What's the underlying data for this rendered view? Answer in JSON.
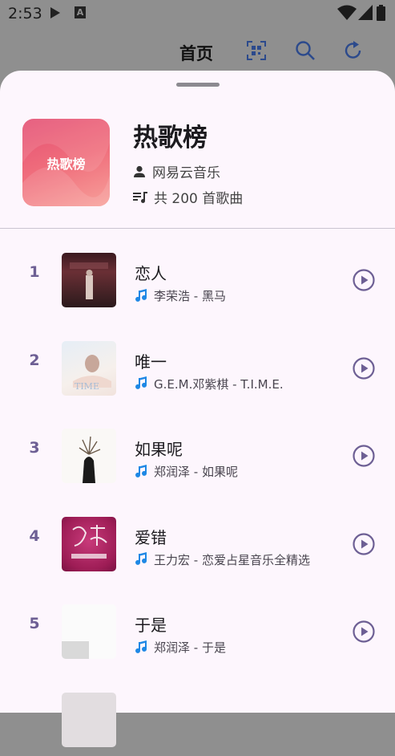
{
  "status_bar": {
    "time": "2:53",
    "a_badge": "A"
  },
  "app_bar": {
    "title": "首页",
    "icons": [
      "qr-scan-icon",
      "search-icon",
      "refresh-icon"
    ]
  },
  "playlist": {
    "cover_text": "热歌榜",
    "title": "热歌榜",
    "creator": "网易云音乐",
    "count_text": "共 200 首歌曲"
  },
  "songs": [
    {
      "rank": "1",
      "title": "恋人",
      "subtitle": "李荣浩 - 黑马"
    },
    {
      "rank": "2",
      "title": "唯一",
      "subtitle": "G.E.M.邓紫棋 - T.I.M.E."
    },
    {
      "rank": "3",
      "title": "如果呢",
      "subtitle": "郑润泽 - 如果呢"
    },
    {
      "rank": "4",
      "title": "爱错",
      "subtitle": "王力宏 - 恋爱占星音乐全精选"
    },
    {
      "rank": "5",
      "title": "于是",
      "subtitle": "郑润泽 - 于是"
    }
  ],
  "colors": {
    "accent": "#6d5f94",
    "note_icon": "#1e88e5",
    "sheet_bg": "#fdf6fd",
    "scrim": "#8f8f8f"
  }
}
